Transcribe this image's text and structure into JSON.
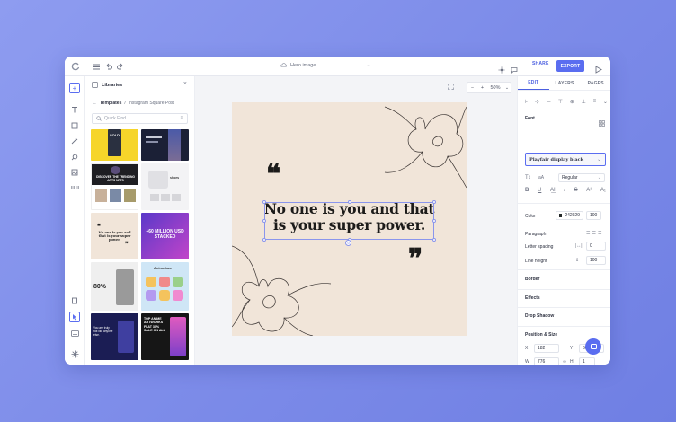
{
  "topbar": {
    "doc_name": "Hero image",
    "share_label": "SHARE",
    "export_label": "EXPORT"
  },
  "library": {
    "title": "Libraries",
    "breadcrumb_root": "Templates",
    "breadcrumb_separator": "/",
    "breadcrumb_current": "Instagram Square Post",
    "search_placeholder": "Quick Find",
    "thumbs": [
      {
        "text": "SOLD"
      },
      {
        "text": ""
      },
      {
        "text": "DISCOVER THE TRENDING ARTS NFTS"
      },
      {
        "text": "shoes"
      },
      {
        "text": "No one is you and that is your super power."
      },
      {
        "text": "+60 MILLION USD STACKED"
      },
      {
        "text": "80%"
      },
      {
        "text": "Animeface"
      },
      {
        "text": "You are truly not like anyone else."
      },
      {
        "text": "TOP ANIME ARTWORKS FLAT 30% SALE ON ALL"
      }
    ]
  },
  "canvas": {
    "zoom": "50%",
    "quote_line1": "No one is you and that",
    "quote_line2": "is your super power.",
    "open_quote": "❝",
    "close_quote": "❞"
  },
  "right": {
    "tabs": [
      "EDIT",
      "LAYERS",
      "PAGES"
    ],
    "font_section": "Font",
    "font_family": "Playfair display black",
    "font_weight": "Regular",
    "color_label": "Color",
    "color_hex": "242929",
    "opacity": "100",
    "paragraph_label": "Paragraph",
    "letter_spacing_label": "Letter spacing",
    "letter_spacing_value": "0",
    "line_height_label": "Line height",
    "line_height_value": "100",
    "border_label": "Border",
    "effects_label": "Effects",
    "shadow_label": "Drop Shadow",
    "position_label": "Position & Size",
    "x_label": "X",
    "x_value": "182",
    "y_label": "Y",
    "y_value": "662",
    "w_label": "W",
    "w_value": "776",
    "h_label": "H",
    "h_value": "1"
  },
  "colors": {
    "accent": "#5a6df0",
    "card_bg": "#f1e5d9",
    "text_dark": "#242929"
  }
}
